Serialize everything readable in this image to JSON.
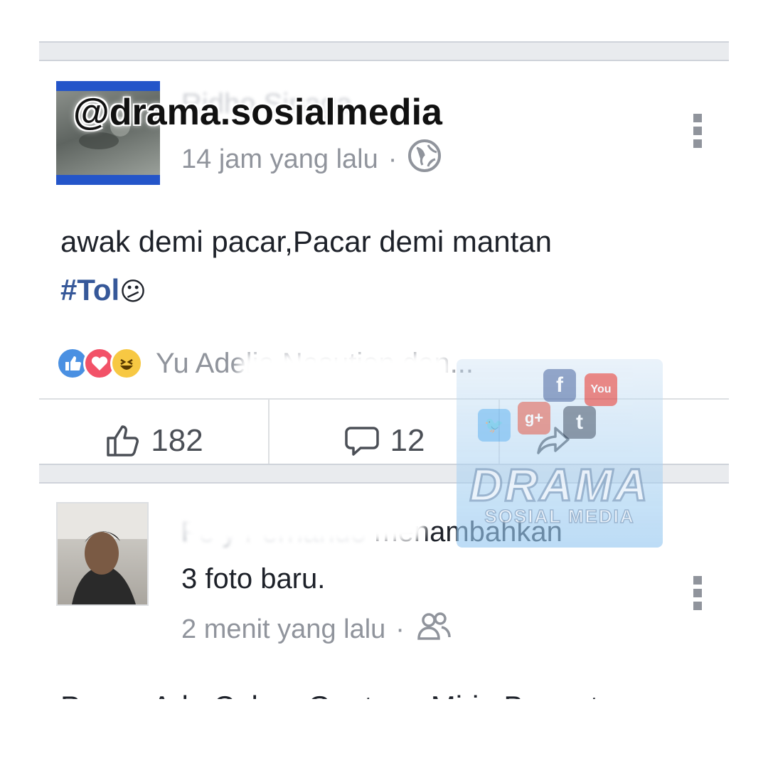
{
  "overlay": {
    "handle": "@drama.sosialmedia"
  },
  "post1": {
    "author": "Ridho Sinaga",
    "time": "14 jam yang lalu",
    "time_separator": "·",
    "privacy_icon": "globe-icon",
    "text_line1": "awak demi pacar,Pacar demi mantan",
    "hashtag": "#Tol",
    "emoji": "😕",
    "reactions": [
      "like",
      "love",
      "haha"
    ],
    "reaction_names": "Yu      Adelia Nasution dan...",
    "like_count": "182",
    "comment_count": "12",
    "colors": {
      "like": "#4a90e2",
      "love": "#f25268",
      "haha": "#f7c843",
      "hashtag": "#365899"
    }
  },
  "post2": {
    "author": "Fe   y Fernando",
    "action": "menambahkan",
    "action_line2": "3 foto baru.",
    "time": "2 menit yang lalu",
    "time_separator": "·",
    "audience_icon": "friends-icon",
    "text": "Punya Ade Cakep,Ganteng,Mirip Banget"
  },
  "watermark": {
    "title": "DRAMA",
    "subtitle": "SOSIAL MEDIA",
    "tile_labels": [
      "f",
      "g+",
      "t",
      "You"
    ]
  }
}
